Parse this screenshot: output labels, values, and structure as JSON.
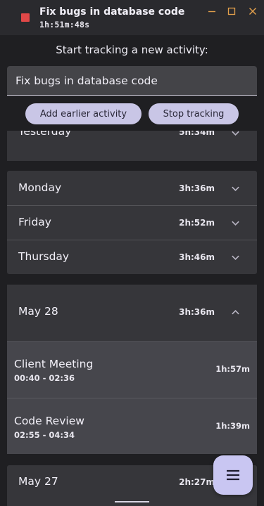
{
  "window": {
    "title": "Fix bugs in database code",
    "timer": "1h:51m:48s",
    "accent_color": "#e3a04c",
    "record_color": "#e04848",
    "controls": [
      "minimize-icon",
      "maximize-icon",
      "close-icon"
    ]
  },
  "tracker": {
    "header": "Start tracking a new activity:",
    "input_value": "Fix bugs in database code",
    "add_earlier_label": "Add earlier activity",
    "stop_label": "Stop tracking"
  },
  "days": {
    "yesterday": {
      "label": "Yesterday",
      "duration": "5h:34m"
    },
    "group1": [
      {
        "label": "Monday",
        "duration": "3h:36m"
      },
      {
        "label": "Friday",
        "duration": "2h:52m"
      },
      {
        "label": "Thursday",
        "duration": "3h:46m"
      }
    ],
    "may28": {
      "label": "May 28",
      "duration": "3h:36m",
      "entries": [
        {
          "title": "Client Meeting",
          "time": "00:40 - 02:36",
          "duration": "1h:57m"
        },
        {
          "title": "Code Review",
          "time": "02:55 - 04:34",
          "duration": "1h:39m"
        }
      ]
    },
    "may27": {
      "label": "May 27",
      "duration": "2h:27m"
    }
  },
  "fab": {
    "icon": "menu-icon",
    "color": "#c9c6f2"
  }
}
